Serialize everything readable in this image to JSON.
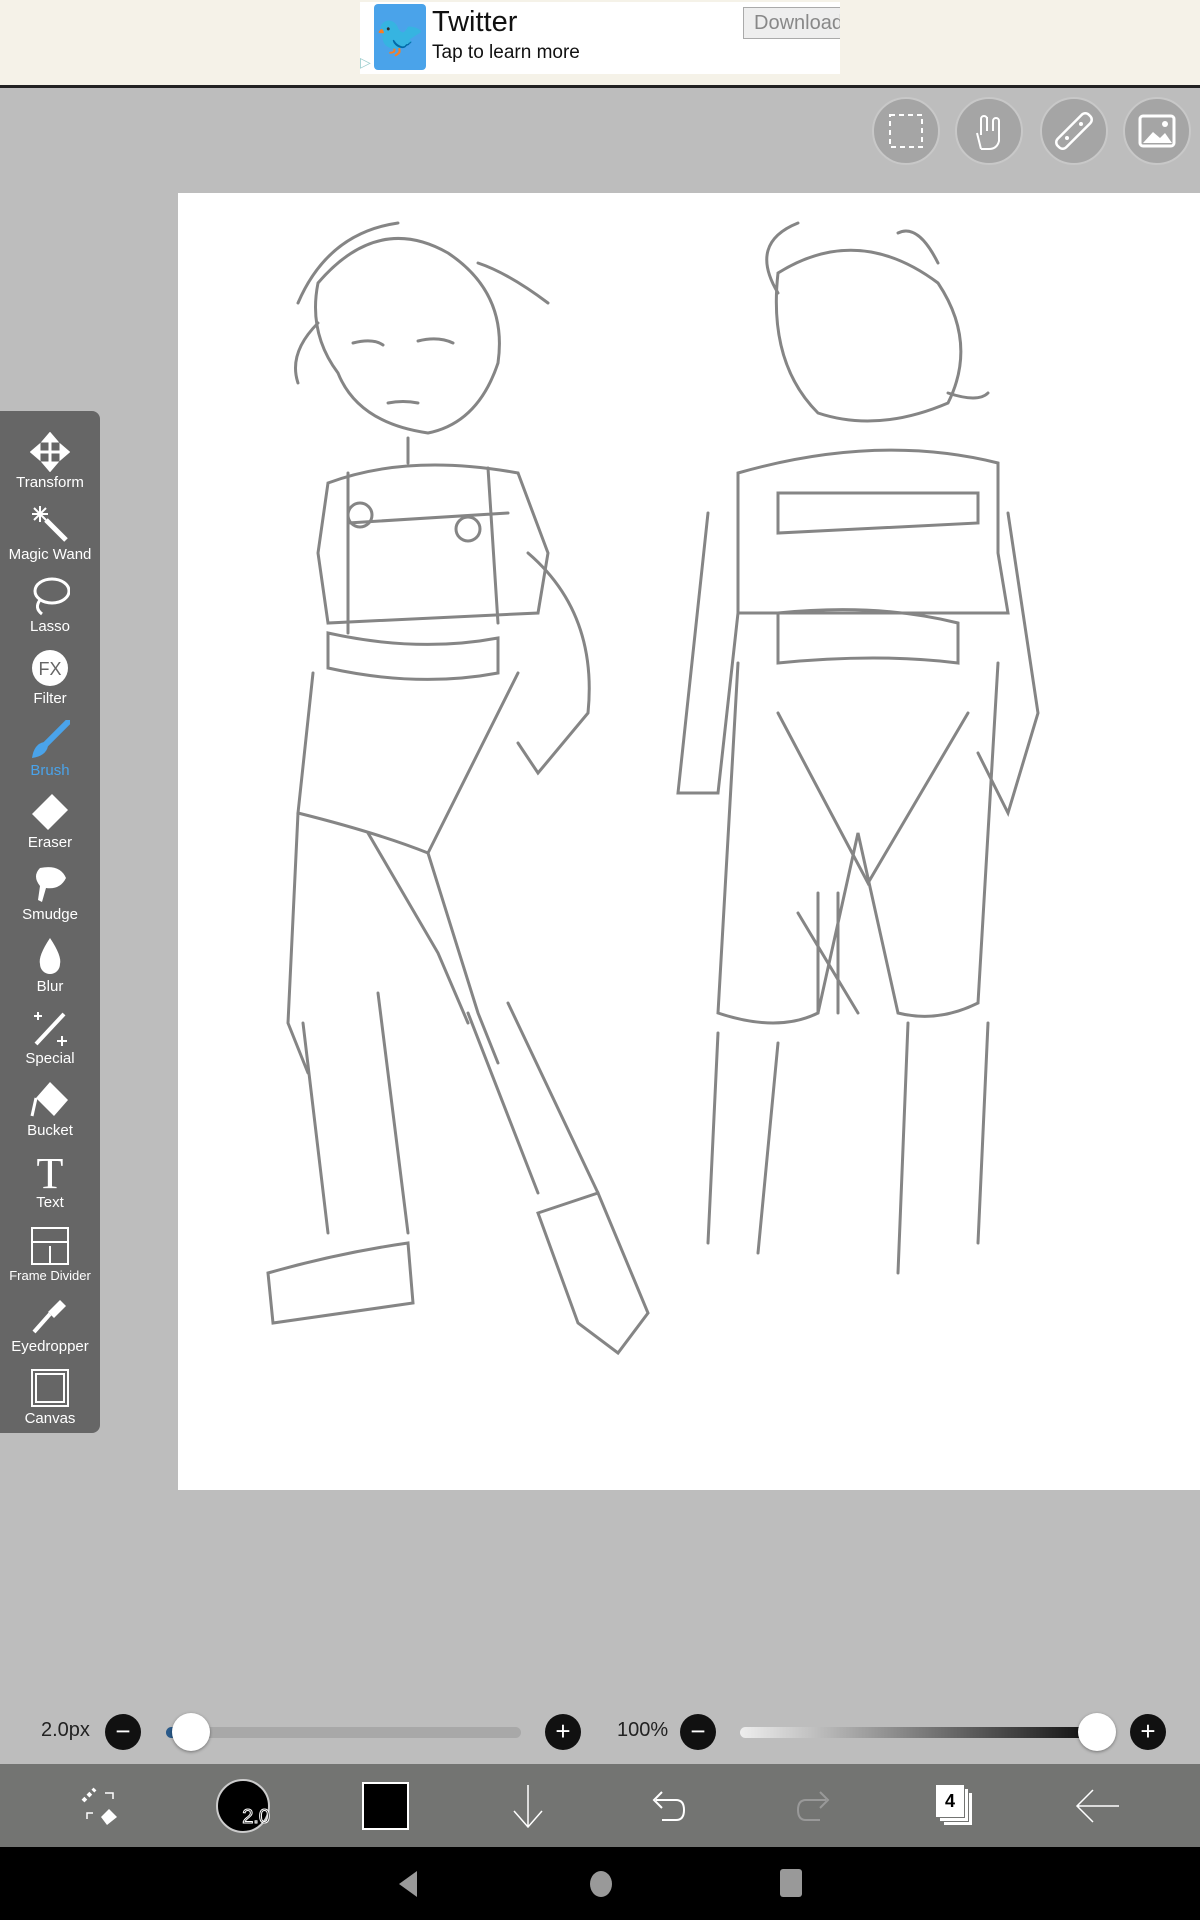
{
  "ad": {
    "title": "Twitter",
    "subtitle": "Tap to learn more",
    "button": "Download",
    "logo": "twitter-bird-icon"
  },
  "top_buttons": [
    "selection-icon",
    "hand-icon",
    "ruler-icon",
    "image-icon"
  ],
  "tools": [
    {
      "label": "Transform",
      "icon": "move-icon"
    },
    {
      "label": "Magic Wand",
      "icon": "magic-wand-icon"
    },
    {
      "label": "Lasso",
      "icon": "lasso-icon"
    },
    {
      "label": "Filter",
      "icon": "fx-icon"
    },
    {
      "label": "Brush",
      "icon": "brush-icon",
      "selected": true
    },
    {
      "label": "Eraser",
      "icon": "eraser-icon"
    },
    {
      "label": "Smudge",
      "icon": "smudge-icon"
    },
    {
      "label": "Blur",
      "icon": "drop-icon"
    },
    {
      "label": "Special",
      "icon": "sparkle-icon"
    },
    {
      "label": "Bucket",
      "icon": "bucket-icon"
    },
    {
      "label": "Text",
      "icon": "text-icon"
    },
    {
      "label": "Frame Divider",
      "icon": "frame-icon"
    },
    {
      "label": "Eyedropper",
      "icon": "eyedropper-icon"
    },
    {
      "label": "Canvas",
      "icon": "canvas-icon"
    }
  ],
  "brush_size": {
    "label": "2.0px",
    "value": 2.0,
    "fraction": 0.03
  },
  "opacity": {
    "label": "100%",
    "value": 100
  },
  "bottom": {
    "brush_size_badge": "2.0",
    "layer_count": "4",
    "color": "#000000"
  },
  "colors": {
    "accent": "#4aa3ea",
    "toolbar": "#666666",
    "background": "#bdbdbd"
  }
}
